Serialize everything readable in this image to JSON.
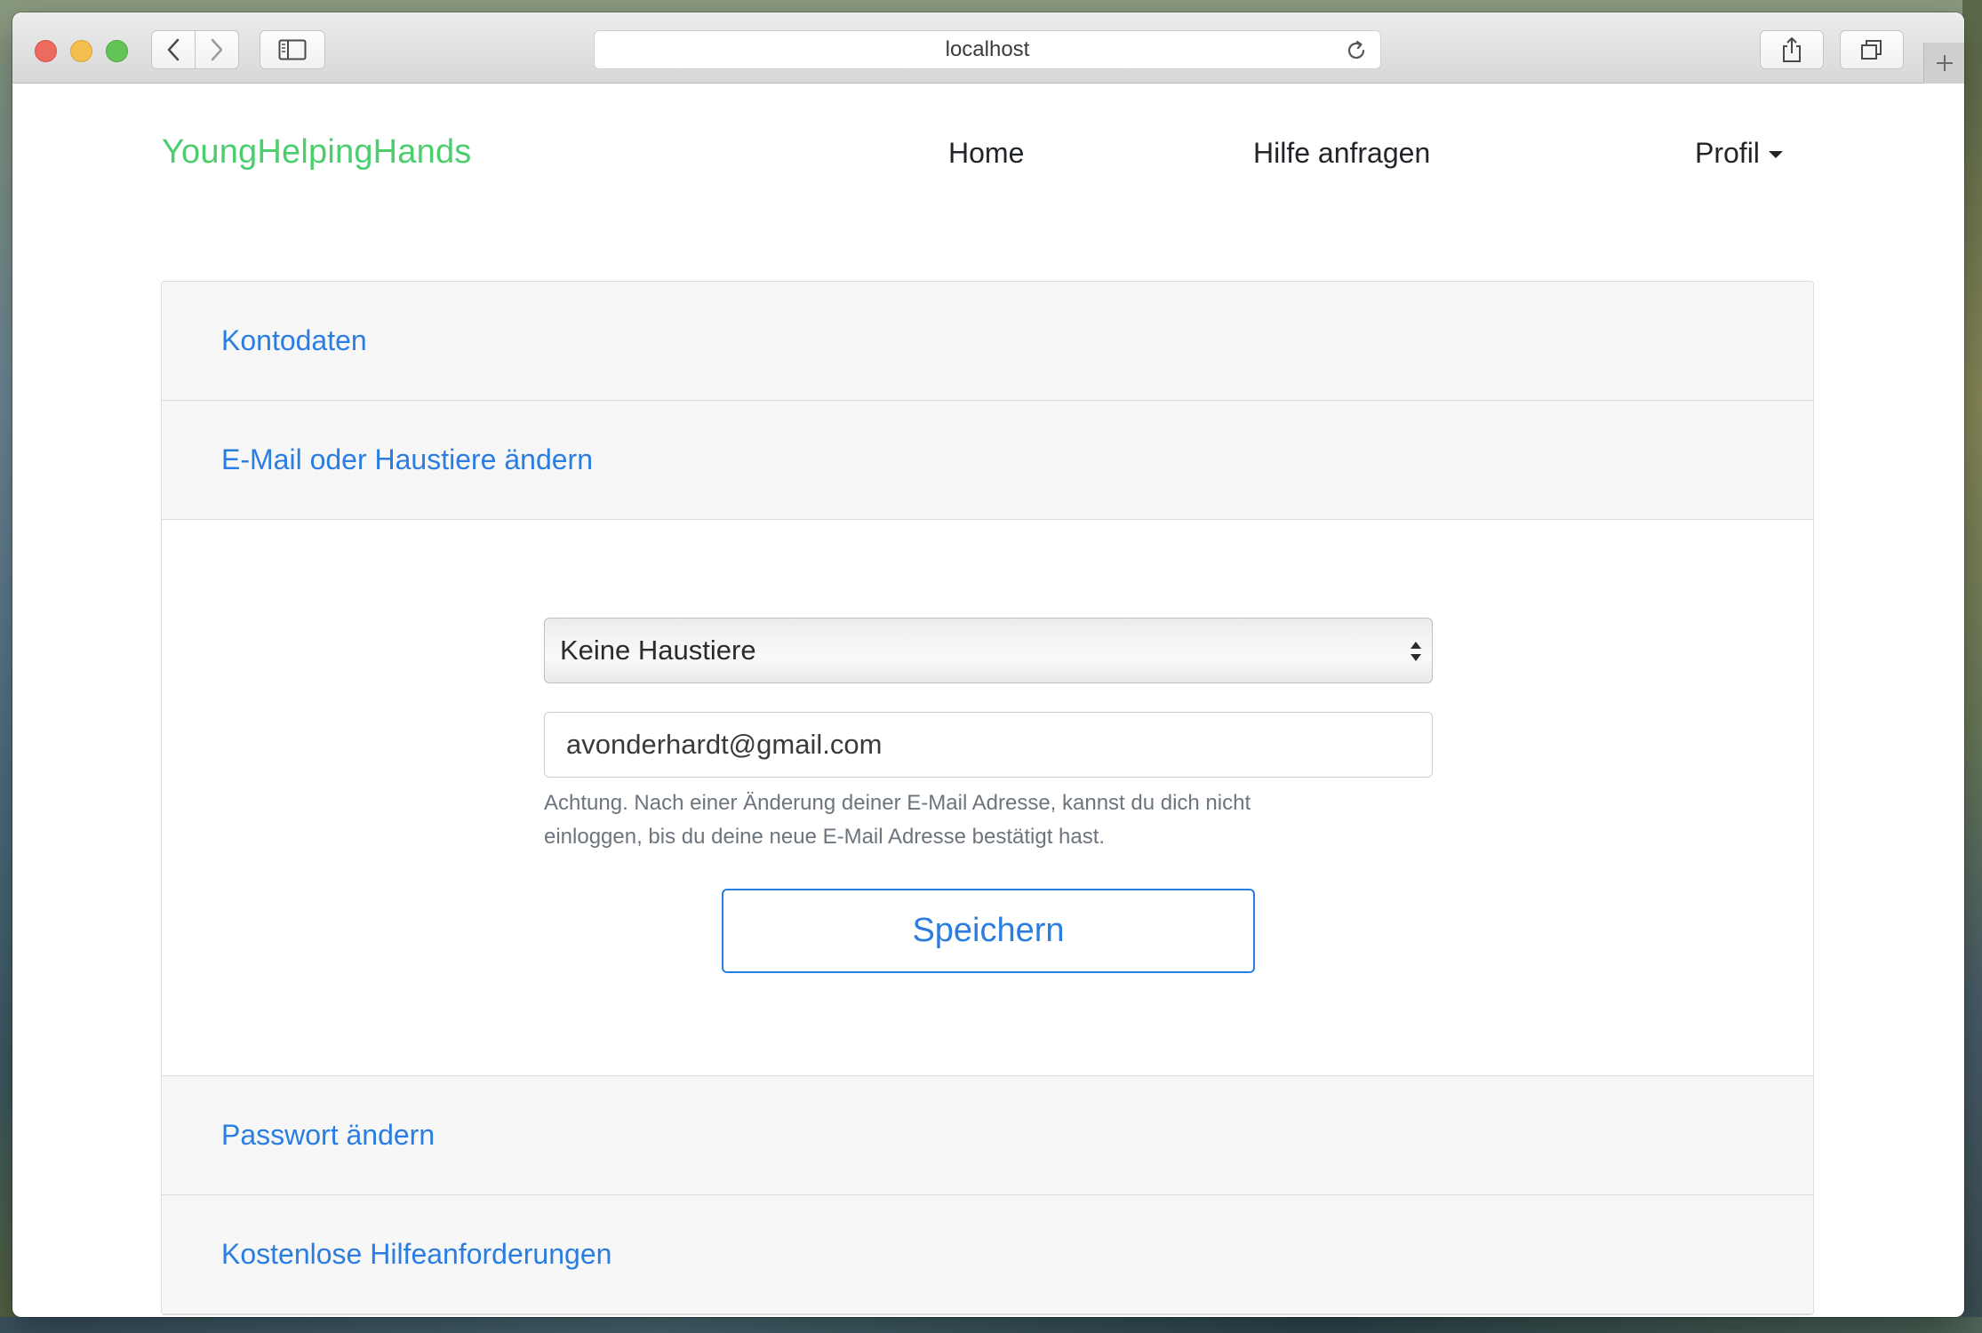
{
  "browser": {
    "url": "localhost"
  },
  "navbar": {
    "brand": "YoungHelpingHands",
    "links": [
      "Home",
      "Hilfe anfragen"
    ],
    "profile_label": "Profil"
  },
  "accordion": {
    "sections": [
      {
        "title": "Kontodaten"
      },
      {
        "title": "E-Mail oder Haustiere ändern"
      },
      {
        "title": "Passwort ändern"
      },
      {
        "title": "Kostenlose Hilfeanforderungen"
      }
    ]
  },
  "form": {
    "pets_select_value": "Keine Haustiere",
    "email_value": "avonderhardt@gmail.com",
    "help_text_line1": "Achtung. Nach einer Änderung deiner E-Mail Adresse, kannst du dich nicht",
    "help_text_line2": "einloggen, bis du deine neue E-Mail Adresse bestätigt hast.",
    "save_label": "Speichern"
  },
  "colors": {
    "brand": "#4ccd6e",
    "link": "#2a7de1",
    "muted_text": "#6c757d"
  }
}
